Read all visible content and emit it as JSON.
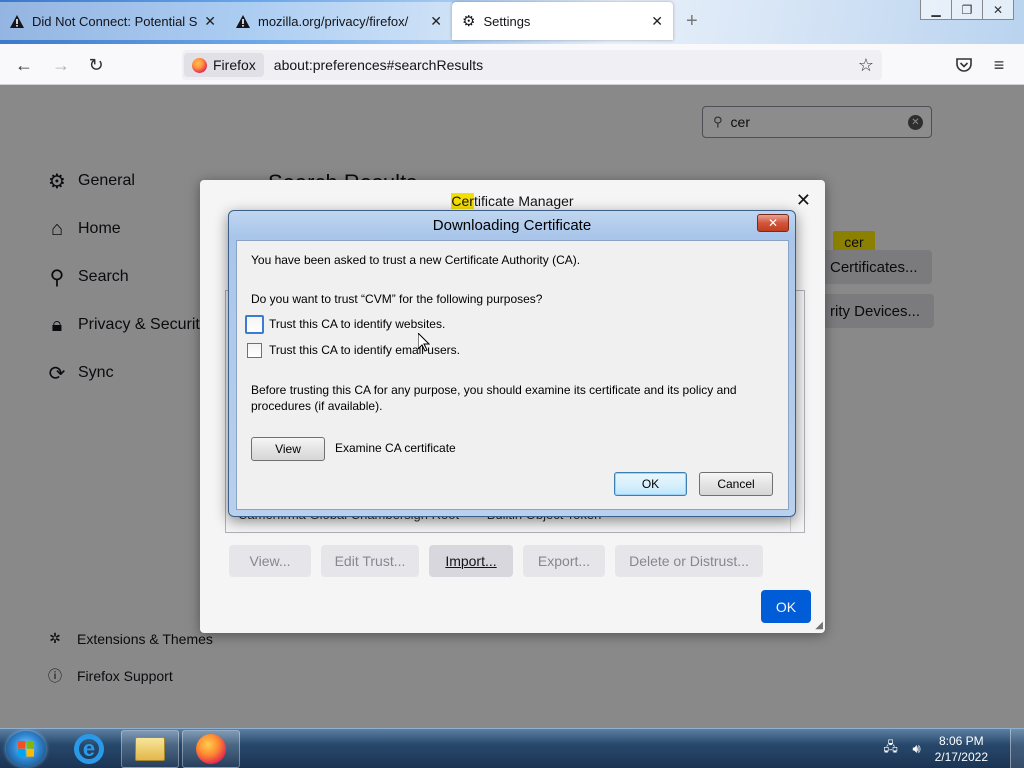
{
  "browser": {
    "tabs": [
      {
        "title": "Did Not Connect: Potential Security Issue",
        "icon": "warning-icon",
        "active": false
      },
      {
        "title": "mozilla.org/privacy/firefox/",
        "icon": "warning-icon",
        "active": false
      },
      {
        "title": "Settings",
        "icon": "gear-icon",
        "active": true
      }
    ],
    "window_buttons": {
      "minimize": "▁",
      "restore": "❐",
      "close": "✕"
    },
    "identity_label": "Firefox",
    "url": "about:preferences#searchResults"
  },
  "settings": {
    "search_value": "cer",
    "results_title": "Search Results",
    "sidebar": [
      {
        "label": "General",
        "icon": "gear-icon"
      },
      {
        "label": "Home",
        "icon": "home-icon"
      },
      {
        "label": "Search",
        "icon": "search-icon"
      },
      {
        "label": "Privacy & Security",
        "icon": "lock-icon"
      },
      {
        "label": "Sync",
        "icon": "sync-icon"
      }
    ],
    "footer": [
      {
        "label": "Extensions & Themes",
        "icon": "puzzle-icon"
      },
      {
        "label": "Firefox Support",
        "icon": "help-icon"
      }
    ],
    "highlight_badge": "cer",
    "view_certificates_label": "Certificates...",
    "security_devices_label": "rity Devices..."
  },
  "cert_manager": {
    "title_hl": "Cer",
    "title_rest": "tificate Manager",
    "row_name": "Camerfirma Global Chambersign Root",
    "row_token": "Builtin Object Token",
    "buttons": {
      "view": "View...",
      "edit_trust": "Edit Trust...",
      "import": "Import...",
      "export": "Export...",
      "delete": "Delete or Distrust..."
    },
    "ok": "OK"
  },
  "download_dialog": {
    "title": "Downloading Certificate",
    "intro": "You have been asked to trust a new Certificate Authority (CA).",
    "question": "Do you want to trust “CVM” for the following purposes?",
    "opt_websites": "Trust this CA to identify websites.",
    "opt_email": "Trust this CA to identify email users.",
    "advice_line1": "Before trusting this CA for any purpose, you should examine its certificate and its policy and",
    "advice_line2": "procedures (if available).",
    "view_button": "View",
    "examine_label": "Examine CA certificate",
    "ok": "OK",
    "cancel": "Cancel",
    "websites_checked": false,
    "email_checked": false
  },
  "taskbar": {
    "time": "8:06 PM",
    "date": "2/17/2022"
  }
}
